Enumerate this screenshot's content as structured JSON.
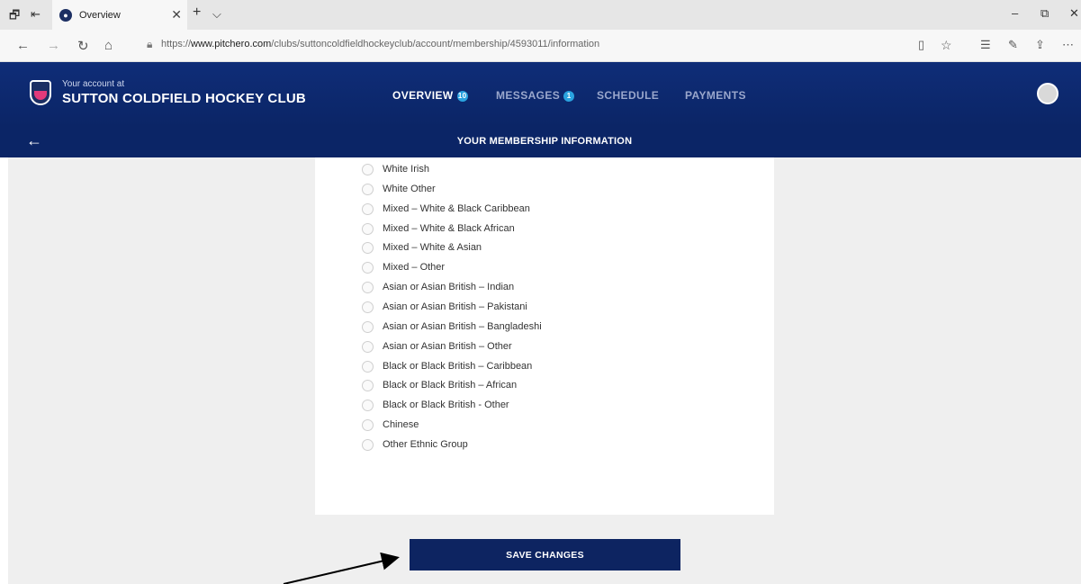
{
  "browser": {
    "tab_title": "Overview",
    "url_prefix": "https://",
    "url_domain": "www.pitchero.com",
    "url_path": "/clubs/suttoncoldfieldhockeyclub/account/membership/4593011/information"
  },
  "header": {
    "account_small": "Your account at",
    "club_name": "SUTTON COLDFIELD HOCKEY CLUB",
    "nav": [
      {
        "label": "OVERVIEW",
        "badge": "10"
      },
      {
        "label": "MESSAGES",
        "badge": "1"
      },
      {
        "label": "SCHEDULE",
        "badge": ""
      },
      {
        "label": "PAYMENTS",
        "badge": ""
      }
    ]
  },
  "subheader": {
    "title": "YOUR MEMBERSHIP INFORMATION"
  },
  "ethnicity_options": [
    "White Irish",
    "White Other",
    "Mixed – White & Black Caribbean",
    "Mixed – White & Black African",
    "Mixed – White & Asian",
    "Mixed – Other",
    "Asian or Asian British – Indian",
    "Asian or Asian British – Pakistani",
    "Asian or Asian British – Bangladeshi",
    "Asian or Asian British – Other",
    "Black or Black British – Caribbean",
    "Black or Black British – African",
    "Black or Black British - Other",
    "Chinese",
    "Other Ethnic Group"
  ],
  "save_button": "SAVE CHANGES",
  "colors": {
    "header_bg": "#0f2d78",
    "button_bg": "#0d2461",
    "badge": "#2aa3e0",
    "watermark": "#f7a6cf"
  }
}
